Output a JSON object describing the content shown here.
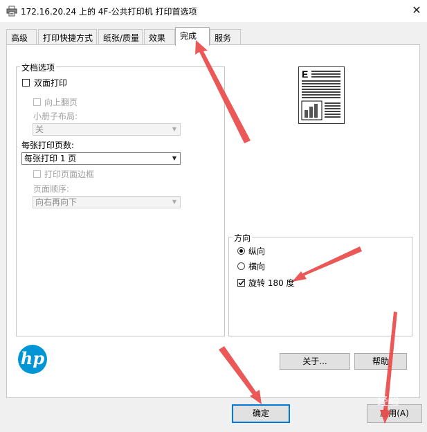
{
  "window": {
    "title": "172.16.20.24 上的 4F-公共打印机 打印首选项",
    "close_glyph": "✕"
  },
  "tabs": [
    {
      "label": "高级",
      "active": false
    },
    {
      "label": "打印快捷方式",
      "active": false
    },
    {
      "label": "纸张/质量",
      "active": false
    },
    {
      "label": "效果",
      "active": false
    },
    {
      "label": "完成",
      "active": true
    },
    {
      "label": "服务",
      "active": false
    }
  ],
  "document_options": {
    "legend": "文档选项",
    "duplex": {
      "label": "双面打印",
      "checked": false
    },
    "flip_up": {
      "label": "向上翻页",
      "checked": false,
      "enabled": false
    },
    "booklet_layout_label": "小册子布局:",
    "booklet_layout_value": "关",
    "pages_per_sheet_label": "每张打印页数:",
    "pages_per_sheet_value": "每张打印 1 页",
    "print_page_borders": {
      "label": "打印页面边框",
      "checked": false,
      "enabled": false
    },
    "page_order_label": "页面顺序:",
    "page_order_value": "向右再向下"
  },
  "preview": {
    "icon": "document-preview-icon",
    "letter": "E"
  },
  "orientation": {
    "legend": "方向",
    "portrait": {
      "label": "纵向",
      "selected": true
    },
    "landscape": {
      "label": "横向",
      "selected": false
    },
    "rotate_180": {
      "label": "旋转 180 度",
      "checked": true
    }
  },
  "logo": {
    "text": "hp",
    "color": "#0096d6"
  },
  "buttons": {
    "about": "关于...",
    "help": "帮助",
    "ok": "确定",
    "apply": "应用(A)"
  },
  "annotations": {
    "arrow_color": "#e84a4a",
    "watermark": "经验"
  }
}
